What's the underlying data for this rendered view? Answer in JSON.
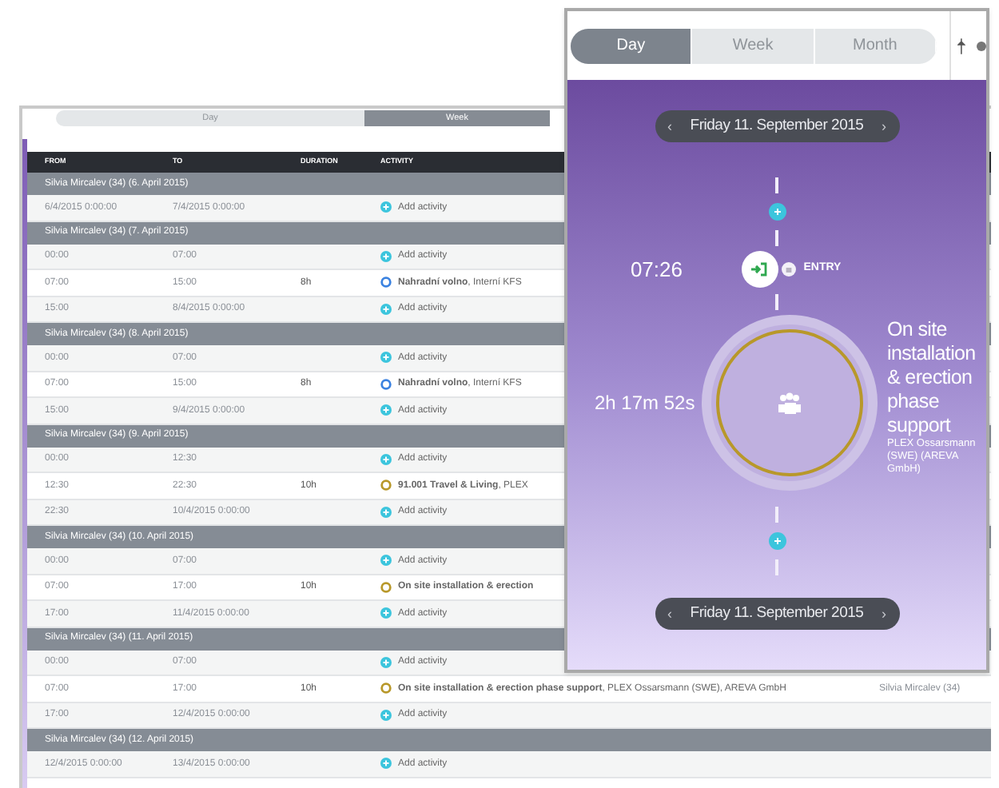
{
  "week_window": {
    "tabs": [
      {
        "label": "Day",
        "selected": false
      },
      {
        "label": "Week",
        "selected": true
      }
    ],
    "table": {
      "columns": [
        "FROM",
        "TO",
        "DURATION",
        "ACTIVITY"
      ],
      "groups": [
        {
          "label": "Silvia Mircalev (34) (6. April 2015)",
          "rows": [
            {
              "from": "6/4/2015 0:00:00",
              "to": "7/4/2015 0:00:00",
              "activity": {
                "kind": "add",
                "text": "Add activity"
              }
            }
          ]
        },
        {
          "label": "Silvia Mircalev (34) (7. April 2015)",
          "rows": [
            {
              "from": "00:00",
              "to": "07:00",
              "activity": {
                "kind": "add",
                "text": "Add activity"
              }
            },
            {
              "from": "07:00",
              "to": "15:00",
              "duration": "8h",
              "activity": {
                "kind": "absence",
                "text": "**Nahradní volno**, Interní KFS"
              }
            },
            {
              "from": "15:00",
              "to": "8/4/2015 0:00:00",
              "activity": {
                "kind": "add",
                "text": "Add activity"
              }
            }
          ]
        },
        {
          "label": "Silvia Mircalev (34) (8. April 2015)",
          "rows": [
            {
              "from": "00:00",
              "to": "07:00",
              "activity": {
                "kind": "add",
                "text": "Add activity"
              }
            },
            {
              "from": "07:00",
              "to": "15:00",
              "duration": "8h",
              "activity": {
                "kind": "absence",
                "text": "**Nahradní volno**, Interní KFS"
              }
            },
            {
              "from": "15:00",
              "to": "9/4/2015 0:00:00",
              "activity": {
                "kind": "add",
                "text": "Add activity"
              }
            }
          ]
        },
        {
          "label": "Silvia Mircalev (34) (9. April 2015)",
          "rows": [
            {
              "from": "00:00",
              "to": "12:30",
              "activity": {
                "kind": "add",
                "text": "Add activity"
              }
            },
            {
              "from": "12:30",
              "to": "22:30",
              "duration": "10h",
              "activity": {
                "kind": "project",
                "text": "**91.001 Travel & Living**, PLEX"
              }
            },
            {
              "from": "22:30",
              "to": "10/4/2015 0:00:00",
              "activity": {
                "kind": "add",
                "text": "Add activity"
              }
            }
          ]
        },
        {
          "label": "Silvia Mircalev (34) (10. April 2015)",
          "rows": [
            {
              "from": "00:00",
              "to": "07:00",
              "activity": {
                "kind": "add",
                "text": "Add activity"
              }
            },
            {
              "from": "07:00",
              "to": "17:00",
              "duration": "10h",
              "activity": {
                "kind": "project",
                "text": "**On site installation & erection**"
              }
            },
            {
              "from": "17:00",
              "to": "11/4/2015 0:00:00",
              "activity": {
                "kind": "add",
                "text": "Add activity"
              }
            }
          ]
        },
        {
          "label": "Silvia Mircalev (34) (11. April 2015)",
          "rows": [
            {
              "from": "00:00",
              "to": "07:00",
              "activity": {
                "kind": "add",
                "text": "Add activity"
              }
            },
            {
              "from": "07:00",
              "to": "17:00",
              "duration": "10h",
              "activity": {
                "kind": "project",
                "text": "**On site installation & erection phase support**, PLEX Ossarsmann (SWE), AREVA GmbH"
              },
              "person": "Silvia Mircalev (34)"
            },
            {
              "from": "17:00",
              "to": "12/4/2015 0:00:00",
              "activity": {
                "kind": "add",
                "text": "Add activity"
              }
            }
          ]
        },
        {
          "label": "Silvia Mircalev (34) (12. April 2015)",
          "rows": [
            {
              "from": "12/4/2015 0:00:00",
              "to": "13/4/2015 0:00:00",
              "activity": {
                "kind": "add",
                "text": "Add activity"
              }
            }
          ]
        }
      ]
    }
  },
  "day_view": {
    "tabs": [
      {
        "label": "Day",
        "selected": true
      },
      {
        "label": "Week",
        "selected": false
      },
      {
        "label": "Month",
        "selected": false
      }
    ],
    "date_nav_top": {
      "prev": "‹",
      "date": "Friday 11. September 2015",
      "next": "›"
    },
    "entry": {
      "time": "07:26",
      "label": "ENTRY"
    },
    "activity": {
      "duration": "2h 17m 52s",
      "title": "On site installation & erection phase support",
      "subtitle": "PLEX Ossarsmann (SWE) (AREVA GmbH)"
    },
    "date_nav_bottom": {
      "prev": "‹",
      "date": "Friday 11. September 2015",
      "next": "›"
    }
  }
}
